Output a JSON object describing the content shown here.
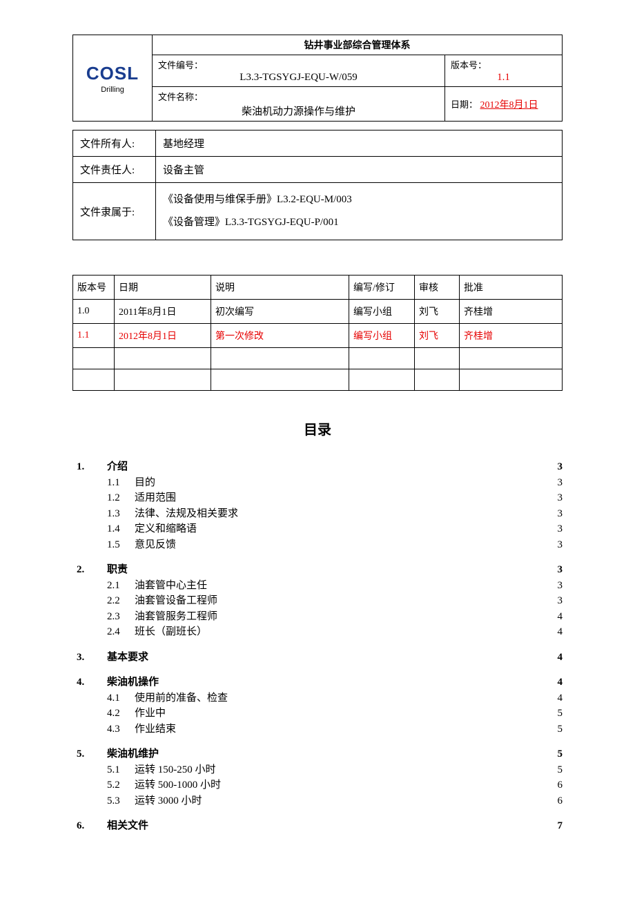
{
  "logo": {
    "main": "COSL",
    "sub": "Drilling"
  },
  "header": {
    "title": "钻井事业部综合管理体系",
    "doc_no_label": "文件编号：",
    "doc_no": "L3.3-TGSYGJ-EQU-W/059",
    "version_label": "版本号：",
    "version": "1.1",
    "name_label": "文件名称：",
    "name": "柴油机动力源操作与维护",
    "date_label": "日期：",
    "date": "2012年8月1日"
  },
  "info": {
    "owner_label": "文件所有人:",
    "owner": "基地经理",
    "responsible_label": "文件责任人:",
    "responsible": "设备主管",
    "belong_label": "文件隶属于:",
    "belong1": "《设备使用与维保手册》L3.2-EQU-M/003",
    "belong2": "《设备管理》L3.3-TGSYGJ-EQU-P/001"
  },
  "rev_headers": {
    "c0": "版本号",
    "c1": "日期",
    "c2": "说明",
    "c3": "编写/修订",
    "c4": "审核",
    "c5": "批准"
  },
  "revisions": [
    {
      "ver": "1.0",
      "date": "2011年8月1日",
      "desc": "初次编写",
      "author": "编写小组",
      "review": "刘飞",
      "approve": "齐桂增",
      "red": false
    },
    {
      "ver": "1.1",
      "date": "2012年8月1日",
      "desc": "第一次修改",
      "author": "编写小组",
      "review": "刘飞",
      "approve": "齐桂增",
      "red": true
    }
  ],
  "toc_title": "目录",
  "toc": [
    {
      "lvl": 1,
      "num": "1.",
      "text": "介绍",
      "page": "3"
    },
    {
      "lvl": 2,
      "num": "1.1",
      "text": "目的",
      "page": "3"
    },
    {
      "lvl": 2,
      "num": "1.2",
      "text": "适用范围",
      "page": "3"
    },
    {
      "lvl": 2,
      "num": "1.3",
      "text": "法律、法规及相关要求",
      "page": "3"
    },
    {
      "lvl": 2,
      "num": "1.4",
      "text": "定义和缩略语",
      "page": "3"
    },
    {
      "lvl": 2,
      "num": "1.5",
      "text": "意见反馈",
      "page": "3"
    },
    {
      "lvl": 1,
      "num": "2.",
      "text": "职责",
      "page": "3"
    },
    {
      "lvl": 2,
      "num": "2.1",
      "text": "油套管中心主任",
      "page": "3"
    },
    {
      "lvl": 2,
      "num": "2.2",
      "text": "油套管设备工程师",
      "page": "3"
    },
    {
      "lvl": 2,
      "num": "2.3",
      "text": "油套管服务工程师",
      "page": "4"
    },
    {
      "lvl": 2,
      "num": "2.4",
      "text": "班长（副班长）",
      "page": "4"
    },
    {
      "lvl": 1,
      "num": "3.",
      "text": "基本要求",
      "page": "4"
    },
    {
      "lvl": 1,
      "num": "4.",
      "text": "柴油机操作",
      "page": "4"
    },
    {
      "lvl": 2,
      "num": "4.1",
      "text": "使用前的准备、检查",
      "page": "4"
    },
    {
      "lvl": 2,
      "num": "4.2",
      "text": "作业中",
      "page": "5"
    },
    {
      "lvl": 2,
      "num": "4.3",
      "text": "作业结束",
      "page": "5"
    },
    {
      "lvl": 1,
      "num": "5.",
      "text": "柴油机维护",
      "page": "5"
    },
    {
      "lvl": 2,
      "num": "5.1",
      "text": "运转 150-250 小时",
      "page": "5"
    },
    {
      "lvl": 2,
      "num": "5.2",
      "text": "运转 500-1000 小时",
      "page": "6"
    },
    {
      "lvl": 2,
      "num": "5.3",
      "text": "运转 3000 小时",
      "page": "6"
    },
    {
      "lvl": 1,
      "num": "6.",
      "text": "相关文件",
      "page": "7"
    }
  ]
}
